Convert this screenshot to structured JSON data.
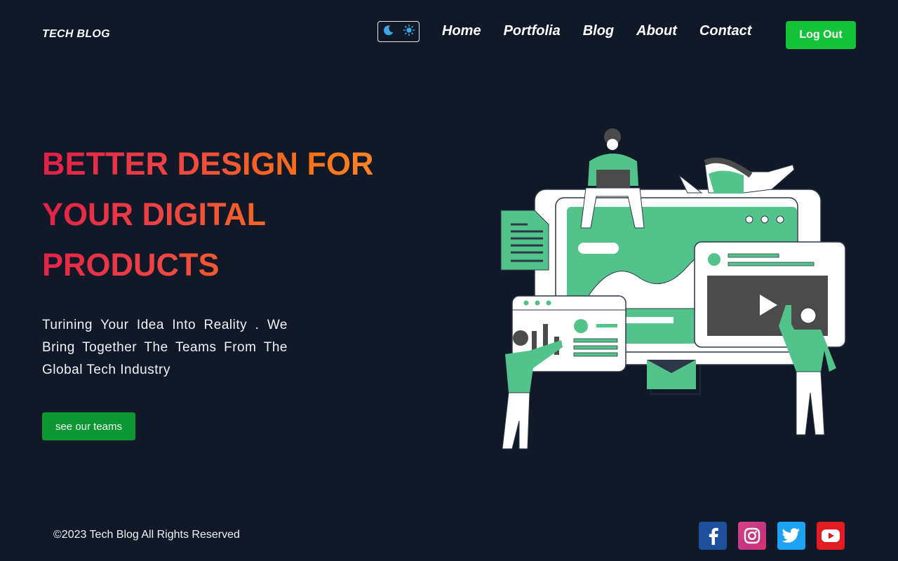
{
  "header": {
    "brand": "TECH BLOG",
    "nav": [
      "Home",
      "Portfolia",
      "Blog",
      "About",
      "Contact"
    ],
    "logout_label": "Log Out"
  },
  "hero": {
    "title_lines": [
      "BETTER DESIGN FOR",
      "YOUR DIGITAL",
      "PRODUCTS"
    ],
    "text": "Turining Your Idea Into Reality . We Bring Together The Teams From The Global Tech Industry",
    "cta_label": "see our teams"
  },
  "footer": {
    "copyright": "©2023 Tech Blog All Rights Reserved",
    "socials": [
      "facebook-icon",
      "instagram-icon",
      "twitter-icon",
      "youtube-icon"
    ]
  },
  "colors": {
    "background": "#111827",
    "accent_green": "#15c33b",
    "illustration_green": "#52c48b",
    "title_gradient": [
      "#e11d48",
      "#f97316"
    ]
  }
}
